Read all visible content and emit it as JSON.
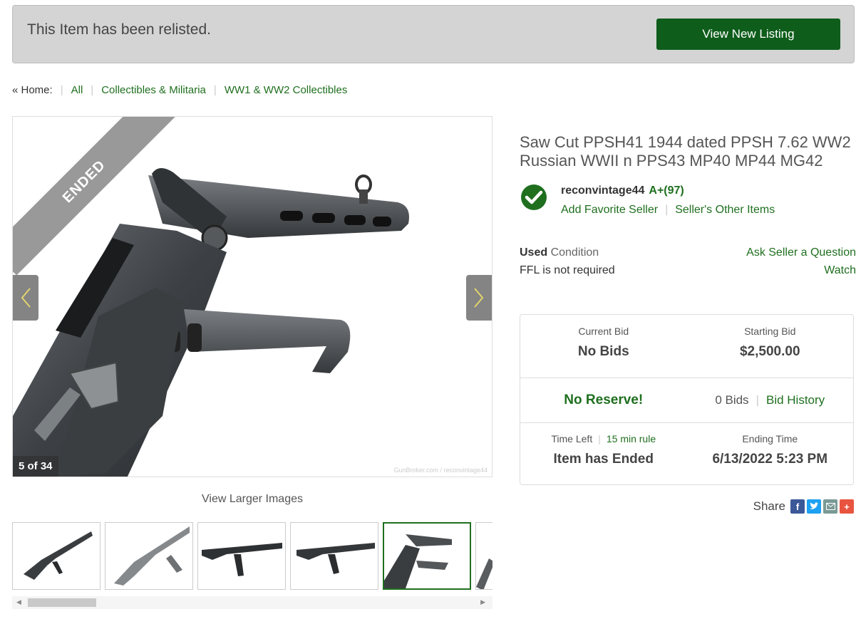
{
  "banner": {
    "message": "This Item has been relisted.",
    "button_label": "View New Listing"
  },
  "breadcrumb": {
    "home": "« Home:",
    "items": [
      "All",
      "Collectibles & Militaria",
      "WW1 & WW2 Collectibles"
    ]
  },
  "gallery": {
    "ended_label": "ENDED",
    "counter": "5 of 34",
    "watermark": "GunBroker.com / reconvintage44",
    "view_larger": "View Larger Images",
    "selected_thumbnail": 5
  },
  "listing": {
    "title": "Saw Cut PPSH41 1944 dated PPSH 7.62 WW2 Russian WWII n PPS43 MP40 MP44 MG42"
  },
  "seller": {
    "name": "reconvintage44",
    "rating": "A+(97)",
    "add_favorite": "Add Favorite Seller",
    "other_items": "Seller's Other Items"
  },
  "condition": {
    "bold": "Used",
    "label": "Condition",
    "ffl": "FFL is not required"
  },
  "actions": {
    "ask": "Ask Seller a Question",
    "watch": "Watch"
  },
  "bid": {
    "current_label": "Current Bid",
    "current_value": "No Bids",
    "starting_label": "Starting Bid",
    "starting_value": "$2,500.00",
    "reserve": "No Reserve!",
    "bids_count": "0 Bids",
    "bid_history": "Bid History",
    "time_left_label": "Time Left",
    "rule": "15 min rule",
    "time_left_value": "Item has Ended",
    "ending_label": "Ending Time",
    "ending_value": "6/13/2022 5:23 PM"
  },
  "share": {
    "label": "Share",
    "icons": [
      "facebook-icon",
      "twitter-icon",
      "email-icon",
      "more-icon"
    ]
  },
  "colors": {
    "accent_green": "#1f6f1f",
    "button_green": "#0e5d1b",
    "banner_bg": "#d4d4d4"
  }
}
